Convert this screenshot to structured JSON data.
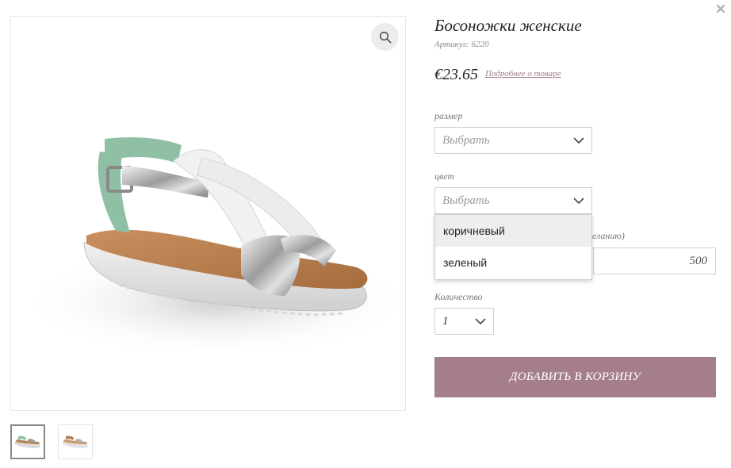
{
  "product": {
    "title": "Босоножки женские",
    "sku": "Артикул: 6220",
    "price": "€23.65",
    "details_link": "Подробнее о товаре"
  },
  "icons": {
    "close": "close-icon",
    "zoom": "magnifier-icon",
    "chevron": "chevron-down-icon"
  },
  "options": {
    "size": {
      "label": "размер",
      "placeholder": "Выбрать"
    },
    "color": {
      "label": "цвет",
      "placeholder": "Выбрать",
      "dropdown_open": true,
      "items": [
        "коричневый",
        "зеленый"
      ]
    },
    "amount": {
      "label_partial": "желанию)",
      "value": "500"
    },
    "quantity": {
      "label": "Количество",
      "value": "1"
    }
  },
  "cart_button": {
    "label": "ДОБАВИТЬ В КОРЗИНУ"
  },
  "colors": {
    "accent": "#a57e8e",
    "link": "#a07a8e"
  }
}
